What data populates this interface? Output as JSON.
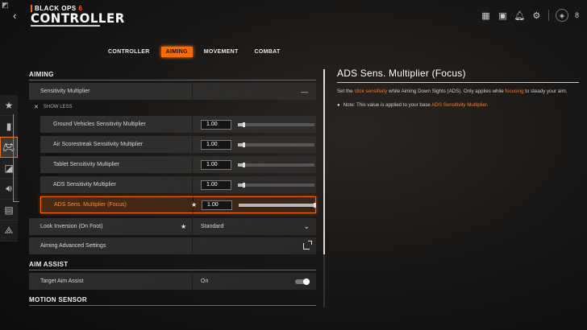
{
  "header": {
    "logo_text": "BLACK OPS",
    "logo_number": "6",
    "title": "CONTROLLER",
    "level": "8"
  },
  "icons": {
    "grid": "grid-icon",
    "store": "store-icon",
    "notifications": "bell-icon",
    "settings": "gear-icon",
    "rank": "rank-icon"
  },
  "tabs": [
    {
      "label": "CONTROLLER",
      "active": false
    },
    {
      "label": "AIMING",
      "active": true
    },
    {
      "label": "MOVEMENT",
      "active": false
    },
    {
      "label": "COMBAT",
      "active": false
    }
  ],
  "sidebar": [
    "star-icon",
    "bullet-icon",
    "gamepad-icon",
    "display-icon",
    "audio-icon",
    "interface-icon",
    "account-icon"
  ],
  "sections": {
    "aiming": "AIMING",
    "aim_assist": "AIM ASSIST",
    "motion_sensor": "MOTION SENSOR"
  },
  "rows": {
    "sensitivity_multiplier": "Sensitivity Multiplier",
    "show_less": "SHOW LESS",
    "sub": [
      {
        "label": "Ground Vehicles Sensitivity Multiplier",
        "value": "1.00",
        "level": 0.08
      },
      {
        "label": "Air Scorestreak Sensitivity Multiplier",
        "value": "1.00",
        "level": 0.08
      },
      {
        "label": "Tablet Sensitivity Multiplier",
        "value": "1.00",
        "level": 0.08
      },
      {
        "label": "ADS Sensitivity Multiplier",
        "value": "1.00",
        "level": 0.08
      },
      {
        "label": "ADS Sens. Multiplier (Focus)",
        "value": "1.00",
        "level": 1.0
      }
    ],
    "look_inversion": {
      "label": "Look Inversion (On Foot)",
      "value": "Standard"
    },
    "aiming_advanced": {
      "label": "Aiming Advanced Settings"
    },
    "target_aim_assist": {
      "label": "Target Aim Assist",
      "value": "On"
    }
  },
  "description": {
    "title": "ADS Sens. Multiplier (Focus)",
    "body_1": "Set the ",
    "body_hl_1": "stick sensitivity",
    "body_2": " while Aiming Down Sights (ADS). Only applies while ",
    "body_hl_2": "focusing",
    "body_3": " to steady your aim.",
    "note_prefix": "Note: This value is applied to your base ",
    "note_hl": "ADS Sensitivity Multiplier",
    "note_suffix": "."
  },
  "colors": {
    "accent": "#ff6a00"
  }
}
